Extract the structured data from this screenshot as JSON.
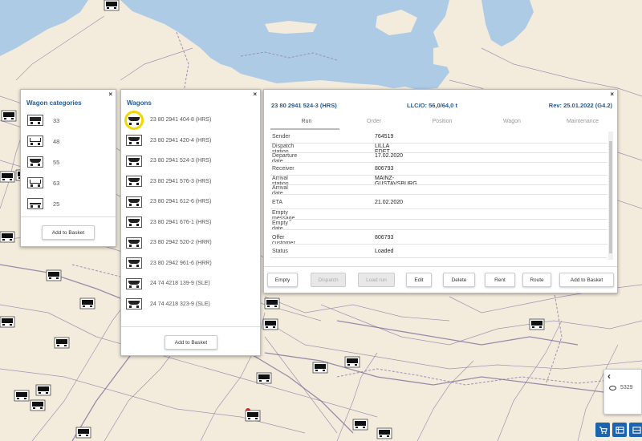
{
  "map": {
    "markers": 32,
    "colors": {
      "land": "#f3ecdc",
      "water": "#aecbe6",
      "rail": "#8a7fa8",
      "border": "#9d8fb3"
    }
  },
  "categories_panel": {
    "title": "Wagon categories",
    "close": "×",
    "items": [
      {
        "icon": "covered-wagon-icon",
        "count": "33"
      },
      {
        "icon": "open-wagon-icon",
        "count": "48"
      },
      {
        "icon": "hopper-wagon-icon",
        "count": "55"
      },
      {
        "icon": "gondola-wagon-icon",
        "count": "63"
      },
      {
        "icon": "flat-wagon-icon",
        "count": "25"
      }
    ],
    "add_button": "Add to Basket"
  },
  "wagons_panel": {
    "title": "Wagons",
    "close": "×",
    "items": [
      "23 80 2941 404-8 (HRS)",
      "23 80 2941 420-4 (HRS)",
      "23 80 2941 524-3 (HRS)",
      "23 80 2941 576-3 (HRS)",
      "23 80 2941 612-6 (HRS)",
      "23 80 2941 676-1 (HRS)",
      "23 80 2942 520-2 (HRR)",
      "23 80 2942 961-6 (HRR)",
      "24 74 4218 139-9 (SLE)",
      "24 74 4218 323-9 (SLE)"
    ],
    "add_button": "Add to Basket"
  },
  "detail_panel": {
    "close": "×",
    "wagon_id": "23 80 2941 524-3 (HRS)",
    "llc": "LLC/O: 56,0/64,0 t",
    "rev": "Rev: 25.01.2022 (G4.2)",
    "tabs": [
      "Run",
      "Order",
      "Position",
      "Wagon",
      "Maintenance"
    ],
    "fields": [
      {
        "label": "Sender",
        "value": "764519"
      },
      {
        "label": "Dispatch station",
        "value": "LILLA EDET"
      },
      {
        "label": "Departure date",
        "value": "17.02.2020"
      },
      {
        "label": "Receiver",
        "value": "806793"
      },
      {
        "label": "Arrival station",
        "value": "MAINZ-GUSTAVSBURG"
      },
      {
        "label": "Arrival date",
        "value": ""
      },
      {
        "label": "ETA",
        "value": "21.02.2020"
      },
      {
        "label": "Empty message",
        "value": ""
      },
      {
        "label": "Empty date",
        "value": ""
      },
      {
        "label": "Offer customer",
        "value": "806793"
      },
      {
        "label": "Status",
        "value": "Loaded"
      }
    ],
    "buttons": [
      "Empty",
      "Dispatch",
      "Load run",
      "Edit",
      "Delete",
      "Rent",
      "Route",
      "Add to Basket"
    ],
    "disabled_buttons": [
      "Dispatch",
      "Load run"
    ]
  },
  "side": {
    "chevron": "‹",
    "count": "5329"
  }
}
